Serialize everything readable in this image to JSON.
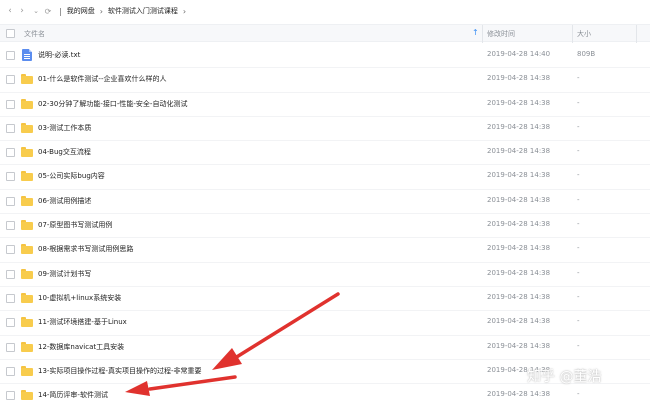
{
  "breadcrumb": {
    "root": "我的网盘",
    "current": "软件测试入门测试课程"
  },
  "header": {
    "name": "文件名",
    "date": "修改时间",
    "size": "大小"
  },
  "files": [
    {
      "name": "说明-必读.txt",
      "date": "2019-04-28 14:40",
      "size": "809B",
      "type": "file"
    },
    {
      "name": "01-什么是软件测试--企业喜欢什么样的人",
      "date": "2019-04-28 14:38",
      "size": "-",
      "type": "folder"
    },
    {
      "name": "02-30分钟了解功能-接口-性能-安全-自动化测试",
      "date": "2019-04-28 14:38",
      "size": "-",
      "type": "folder"
    },
    {
      "name": "03-测试工作本质",
      "date": "2019-04-28 14:38",
      "size": "-",
      "type": "folder"
    },
    {
      "name": "04-Bug交互流程",
      "date": "2019-04-28 14:38",
      "size": "-",
      "type": "folder"
    },
    {
      "name": "05-公司实际bug内容",
      "date": "2019-04-28 14:38",
      "size": "-",
      "type": "folder"
    },
    {
      "name": "06-测试用例描述",
      "date": "2019-04-28 14:38",
      "size": "-",
      "type": "folder"
    },
    {
      "name": "07-原型图书写测试用例",
      "date": "2019-04-28 14:38",
      "size": "-",
      "type": "folder"
    },
    {
      "name": "08-根据需求书写测试用例思路",
      "date": "2019-04-28 14:38",
      "size": "-",
      "type": "folder"
    },
    {
      "name": "09-测试计划书写",
      "date": "2019-04-28 14:38",
      "size": "-",
      "type": "folder"
    },
    {
      "name": "10-虚拟机+linux系统安装",
      "date": "2019-04-28 14:38",
      "size": "-",
      "type": "folder"
    },
    {
      "name": "11-测试环境搭建-基于Linux",
      "date": "2019-04-28 14:38",
      "size": "-",
      "type": "folder"
    },
    {
      "name": "12-数据库navicat工具安装",
      "date": "2019-04-28 14:38",
      "size": "-",
      "type": "folder"
    },
    {
      "name": "13-实际项目操作过程-真实项目操作的过程-非常重要",
      "date": "2019-04-28 14:38",
      "size": "-",
      "type": "folder"
    },
    {
      "name": "14-简历评审-软件测试",
      "date": "2019-04-28 14:38",
      "size": "-",
      "type": "folder"
    }
  ],
  "watermark": "知乎 @董浩",
  "colors": {
    "accent": "#3b8ff5",
    "folder": "#f8cc4d",
    "annotation_arrow": "#e0322e"
  }
}
